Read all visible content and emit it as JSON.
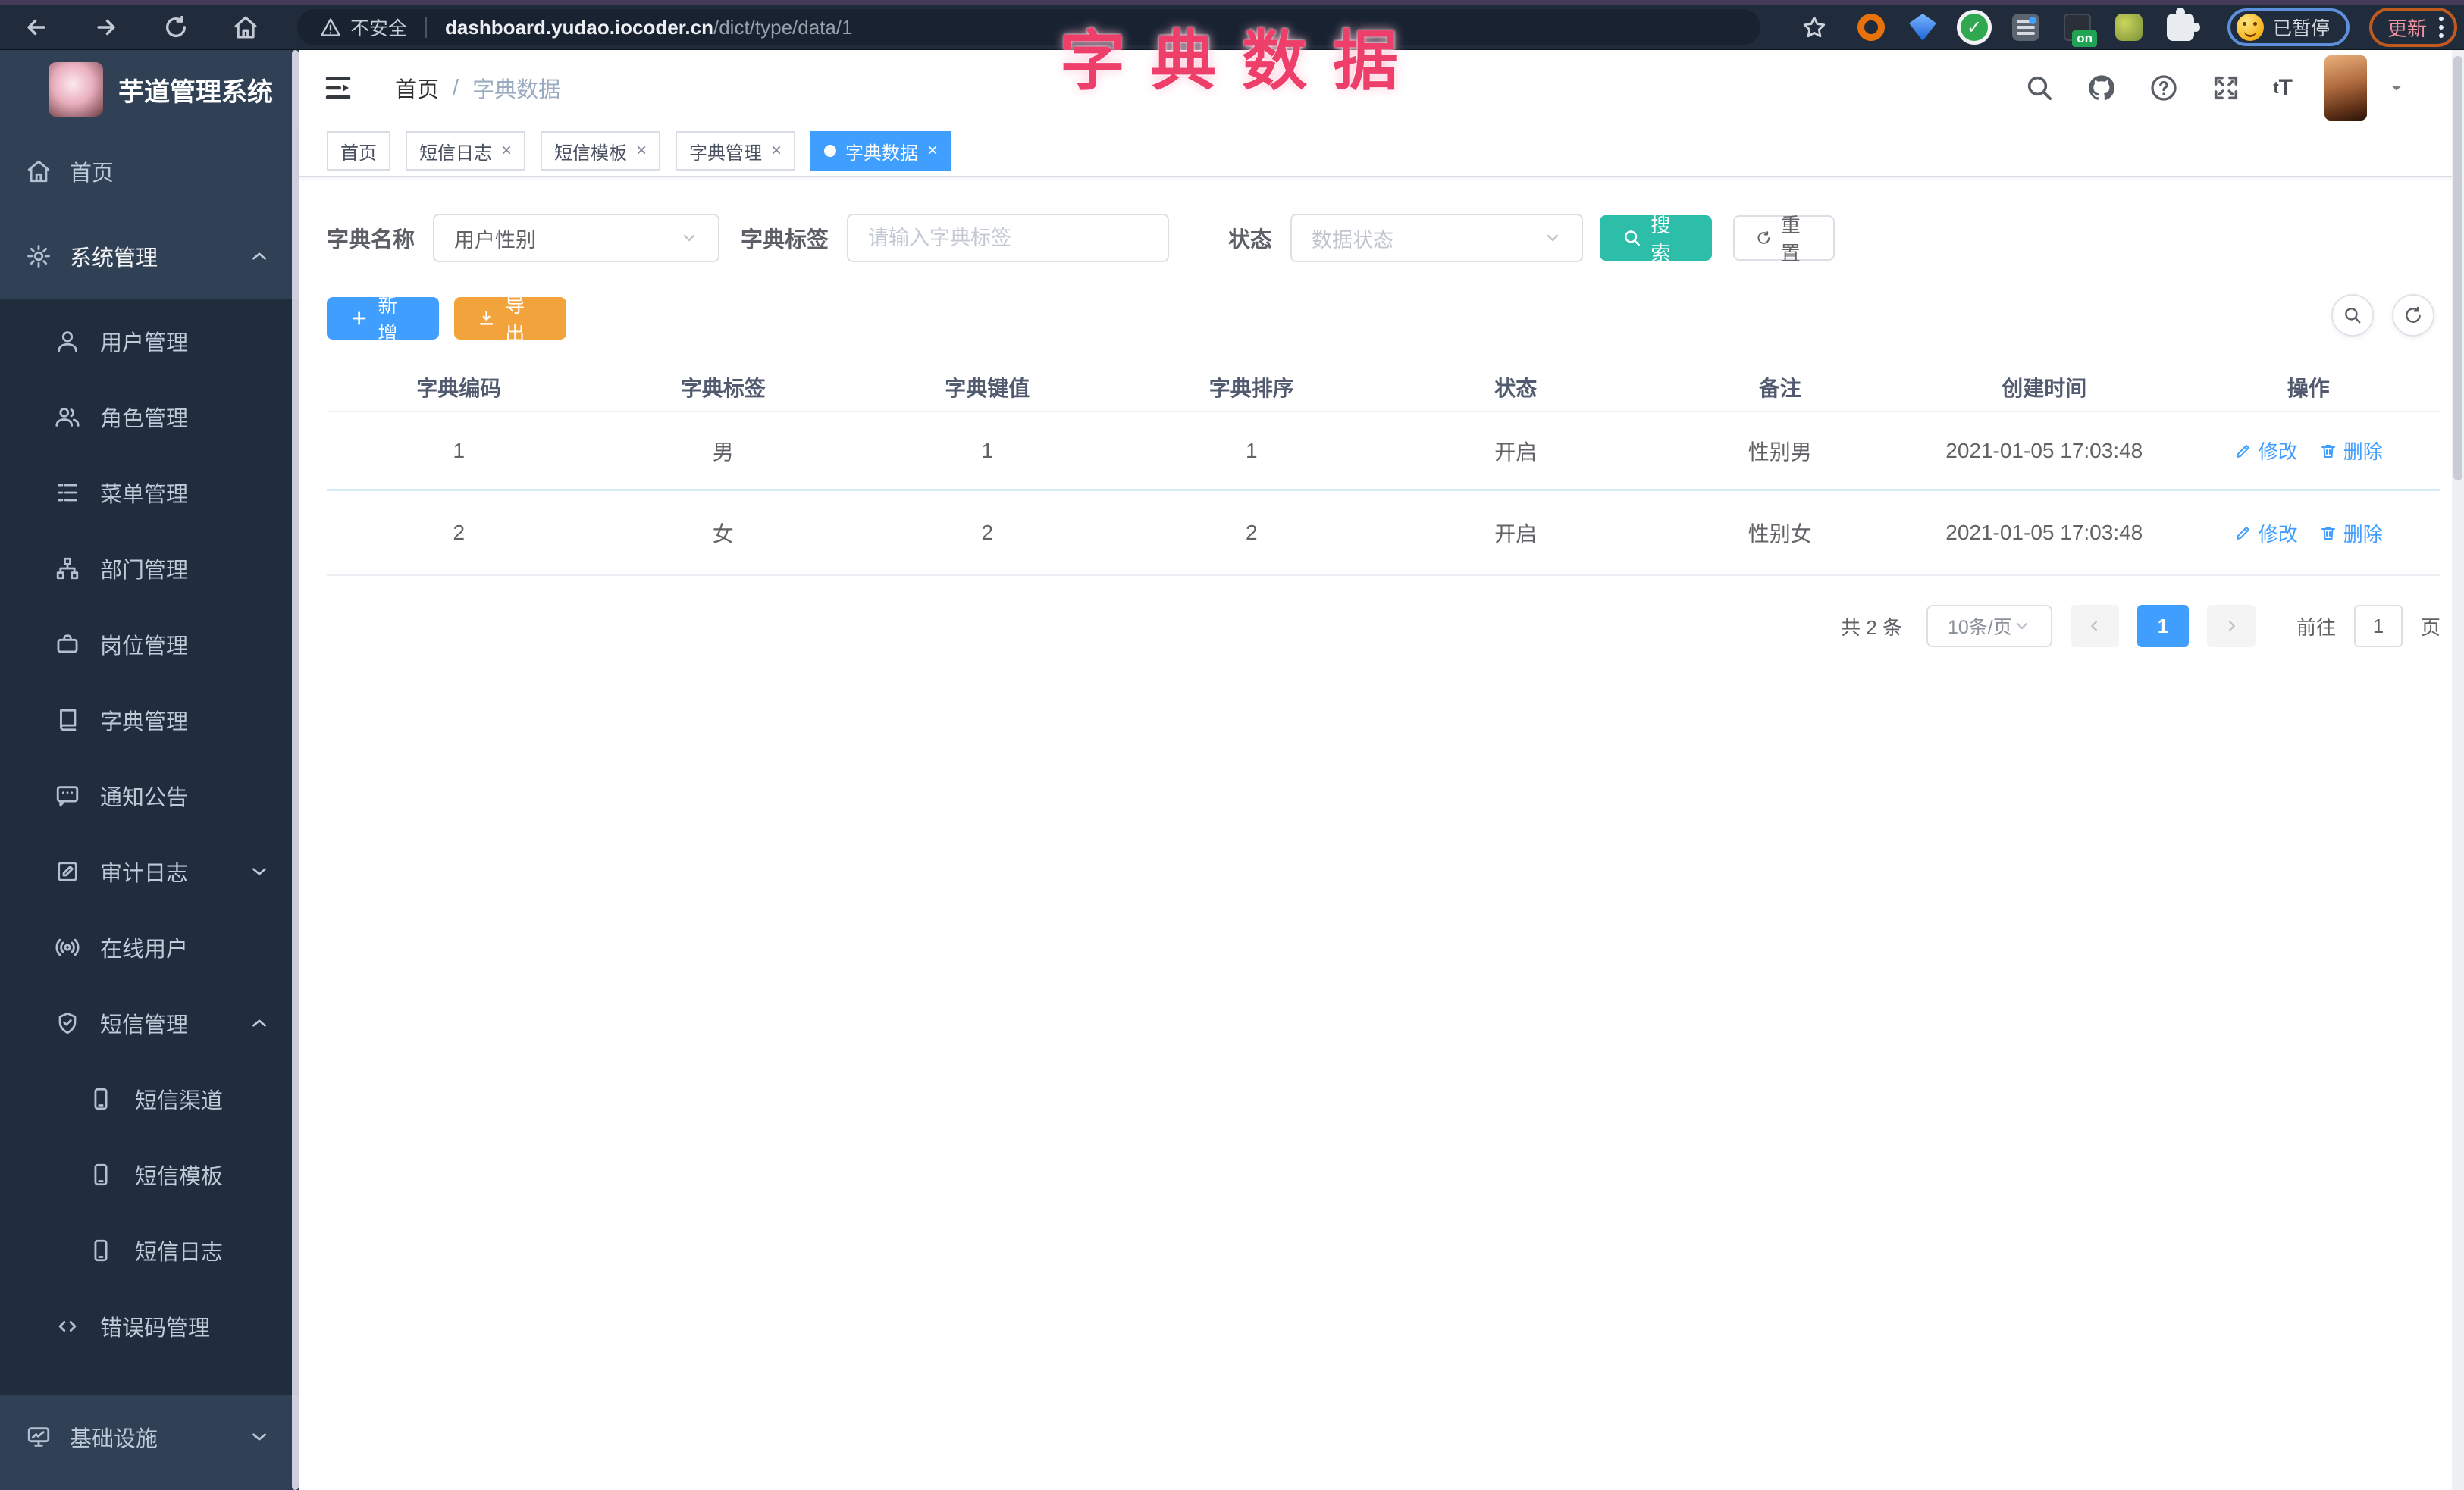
{
  "annotation": {
    "text": "字典数据"
  },
  "browser": {
    "security_label": "不安全",
    "url_host": "dashboard.yudao.iocoder.cn",
    "url_path": "/dict/type/data/1",
    "extension_badge": "on",
    "paused_label": "已暂停",
    "update_label": "更新"
  },
  "sidebar": {
    "title": "芋道管理系统",
    "items": [
      {
        "label": "首页"
      },
      {
        "label": "系统管理"
      },
      {
        "label": "用户管理"
      },
      {
        "label": "角色管理"
      },
      {
        "label": "菜单管理"
      },
      {
        "label": "部门管理"
      },
      {
        "label": "岗位管理"
      },
      {
        "label": "字典管理"
      },
      {
        "label": "通知公告"
      },
      {
        "label": "审计日志"
      },
      {
        "label": "在线用户"
      },
      {
        "label": "短信管理"
      },
      {
        "label": "短信渠道"
      },
      {
        "label": "短信模板"
      },
      {
        "label": "短信日志"
      },
      {
        "label": "错误码管理"
      },
      {
        "label": "基础设施"
      }
    ]
  },
  "header": {
    "breadcrumb_home": "首页",
    "breadcrumb_sep": "/",
    "breadcrumb_current": "字典数据",
    "font_icon_label": "tT"
  },
  "tabs": [
    {
      "label": "首页"
    },
    {
      "label": "短信日志"
    },
    {
      "label": "短信模板"
    },
    {
      "label": "字典管理"
    },
    {
      "label": "字典数据"
    }
  ],
  "tab_close": "×",
  "filters": {
    "dict_name_label": "字典名称",
    "dict_name_value": "用户性别",
    "dict_label_label": "字典标签",
    "dict_label_placeholder": "请输入字典标签",
    "status_label": "状态",
    "status_placeholder": "数据状态",
    "search_label": "搜索",
    "reset_label": "重置"
  },
  "actions": {
    "add_label": "新增",
    "export_label": "导出"
  },
  "table": {
    "columns": [
      "字典编码",
      "字典标签",
      "字典键值",
      "字典排序",
      "状态",
      "备注",
      "创建时间",
      "操作"
    ],
    "rows": [
      {
        "code": "1",
        "label": "男",
        "value": "1",
        "sort": "1",
        "status": "开启",
        "remark": "性别男",
        "created": "2021-01-05 17:03:48"
      },
      {
        "code": "2",
        "label": "女",
        "value": "2",
        "sort": "2",
        "status": "开启",
        "remark": "性别女",
        "created": "2021-01-05 17:03:48"
      }
    ],
    "edit_label": "修改",
    "delete_label": "删除"
  },
  "pagination": {
    "total_text": "共 2 条",
    "page_size": "10条/页",
    "current_page": "1",
    "goto_label": "前往",
    "goto_value": "1",
    "page_label": "页"
  },
  "colors": {
    "accent_blue": "#409eff",
    "teal": "#2cbea9",
    "amber": "#f2a33c",
    "annotation_pink": "#ee3f6b",
    "sidebar_bg": "#304156",
    "submenu_bg": "#1f2d3d"
  }
}
